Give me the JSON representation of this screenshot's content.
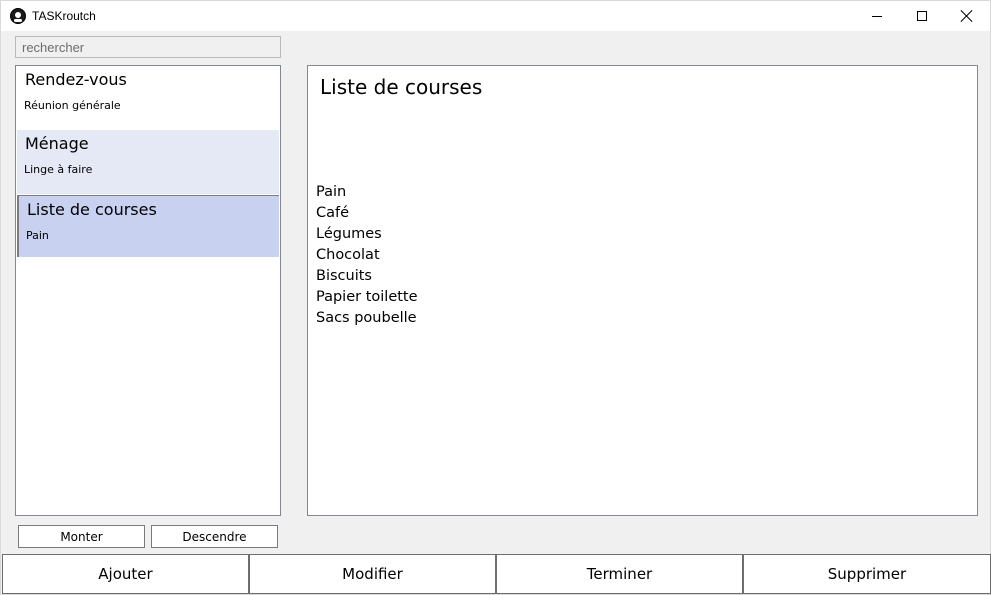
{
  "window": {
    "title": "TASKroutch",
    "app_icon": "skull-icon",
    "controls": {
      "minimize": "minimize-icon",
      "maximize": "maximize-icon",
      "close": "close-icon"
    }
  },
  "search": {
    "placeholder": "rechercher",
    "value": ""
  },
  "tasks": [
    {
      "title": "Rendez-vous",
      "subtitle": "Réunion générale",
      "selected": false
    },
    {
      "title": "Ménage",
      "subtitle": "Linge à faire",
      "selected": false
    },
    {
      "title": "Liste de courses",
      "subtitle": "Pain",
      "selected": true
    }
  ],
  "order_buttons": {
    "up": "Monter",
    "down": "Descendre"
  },
  "detail": {
    "title": "Liste de courses",
    "lines": [
      "Pain",
      "Café",
      "Légumes",
      "Chocolat",
      "Biscuits",
      "Papier toilette",
      "Sacs poubelle"
    ]
  },
  "actions": {
    "add": "Ajouter",
    "edit": "Modifier",
    "finish": "Terminer",
    "delete": "Supprimer"
  },
  "colors": {
    "hover_item": "#e5e8f5",
    "selected_item": "#c9d1f1"
  }
}
